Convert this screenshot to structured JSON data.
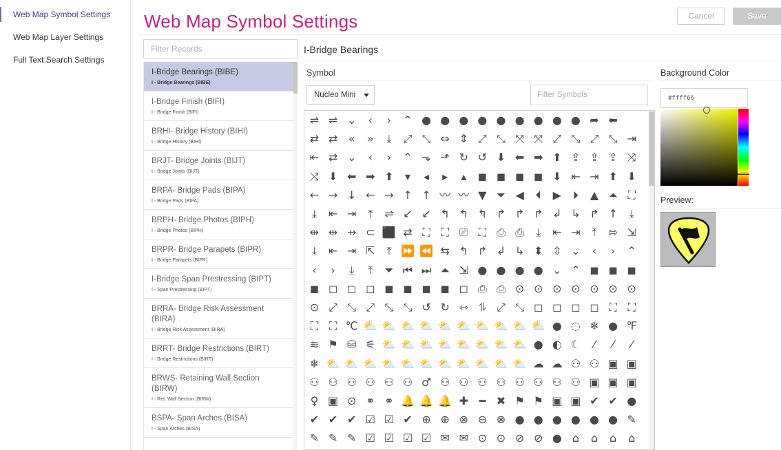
{
  "sidebar": {
    "items": [
      {
        "label": "Web Map Symbol Settings",
        "active": true
      },
      {
        "label": "Web Map Layer Settings",
        "active": false
      },
      {
        "label": "Full Text Search Settings",
        "active": false
      }
    ]
  },
  "header": {
    "title": "Web Map Symbol Settings",
    "cancel_label": "Cancel",
    "save_label": "Save"
  },
  "records": {
    "filter_placeholder": "Filter Records",
    "items": [
      {
        "title": "I-Bridge Bearings (BIBE)",
        "sub": "I - Bridge Bearings (BIBE)",
        "selected": true
      },
      {
        "title": "I-Bridge Finish (BIFI)",
        "sub": "I - Bridge Finish (BIFI)"
      },
      {
        "title": "BRHI- Bridge History (BIHI)",
        "sub": "I - Bridge History (BIHI)"
      },
      {
        "title": "BRJT- Bridge Joints (BIJT)",
        "sub": "I - Bridge Joints (BIJT)"
      },
      {
        "title": "BRPA- Bridge Pads (BIPA)",
        "sub": "I - Bridge Pads (BIPA)"
      },
      {
        "title": "BRPH- Bridge Photos (BIPH)",
        "sub": "I - Bridge Photos (BIPH)"
      },
      {
        "title": "BRPR- Bridge Parapets (BIPR)",
        "sub": "I - Bridge Parapets (BIPR)"
      },
      {
        "title": "I-Bridge Span Prestressing (BIPT)",
        "sub": "I - Span Prestressing (BIPT)"
      },
      {
        "title": "BRRA- Bridge Risk Assessment (BIRA)",
        "sub": "I - Bridge Risk Assessment (BIRA)"
      },
      {
        "title": "BRRT- Bridge Restrictions (BIRT)",
        "sub": "I - Bridge Restrictions (BIRT)"
      },
      {
        "title": "BRWS- Retaining Wall Section (BIRW)",
        "sub": "I - Ret. Wall Section (BIRW)"
      },
      {
        "title": "BSPA- Span Arches (BISA)",
        "sub": "I - Span Arches (BISA)"
      }
    ]
  },
  "detail": {
    "title": "I-Bridge Bearings",
    "symbol_label": "Symbol",
    "font_select": "Nucleo Mini",
    "filter_symbols_placeholder": "Filter Symbols",
    "background_label": "Background Color",
    "color_value": "#ffff66",
    "preview_label": "Preview:",
    "preview_icon": "flag-guitar-pick-icon",
    "accent_color": "#c6217f",
    "symbol_rows": [
      "⇌⇌⌄‹›⌃●●●●●●●●●➦⬅",
      "⇄⇄«»⤓⤢⤡⇔⇕⤢⤡⤧⤧⤢⤡⤢⤡⇥",
      "⇤⇄⌄‹›⌃⬎⬏↻↺⬇⬅➡⬆⇪⇪⇪⤨",
      "⤨⬇⬅➡⬆▾◂▸▴◼◼◼◼⬇⇤⇥⬆⬇",
      "←→↓←→↑↑〰〰▼⏷◀⏴▶⏵▲⏶⛶",
      "⤓⇤⇥⤒⇌↙↙↰↰↰↱↱↱↲↳↱↑⤓",
      "⇹⇹⇸⊂⬛⇄⛶⛶⎚⛶⎙⎙⤓⇤⇥⤒⇰⇲",
      "⤓⇤⇥⇱⤒⏩⏪⇆↰↱↲↳⬍⇳⌄‹›⌃",
      "‹›⤓⤒⏷⏮⏭⏶⇲●●●●⌄⌃◼◼◼",
      "◼◻◻◻◼◼◼◼◻⎙⎙⊙⊙⊙⊙⊙⊙⊙",
      "⊙⤢⤡⤢⤡⤡↺↻⇿⥮⤢⤡◻◻◻◻⛶⛶",
      "⛶⛶℃⛅⛅⛅⛅⛅⛅⛅⛅⛅⛅●◌❄●℉",
      "≋⚑⛁⚟⛅⛅⛅⛅⛅⛅⛅⛅●◐☾⁄⁄⁄",
      "❄⛅⛅⛅⛅⛅⛅⛅⛅⛅⛅⛅☁☁⚇⚇▣▣",
      "⚇⚇⚇⚇⚇⚇♂⚇⚇⚇⚇⚇⚇⚇⚇▣▣▣",
      "♀▣⊙⚭⚭🔔🔔🔔✚━✖⚑⚑▣▣✔✔●",
      "✔✔✔☑☑✔⊕⊕⊗⊖⊗●●●●●●✎",
      "✎✎✎☑☑☑☑✉✉⊙⊙⊘⊘●⌂⌂⌂⌂"
    ]
  }
}
